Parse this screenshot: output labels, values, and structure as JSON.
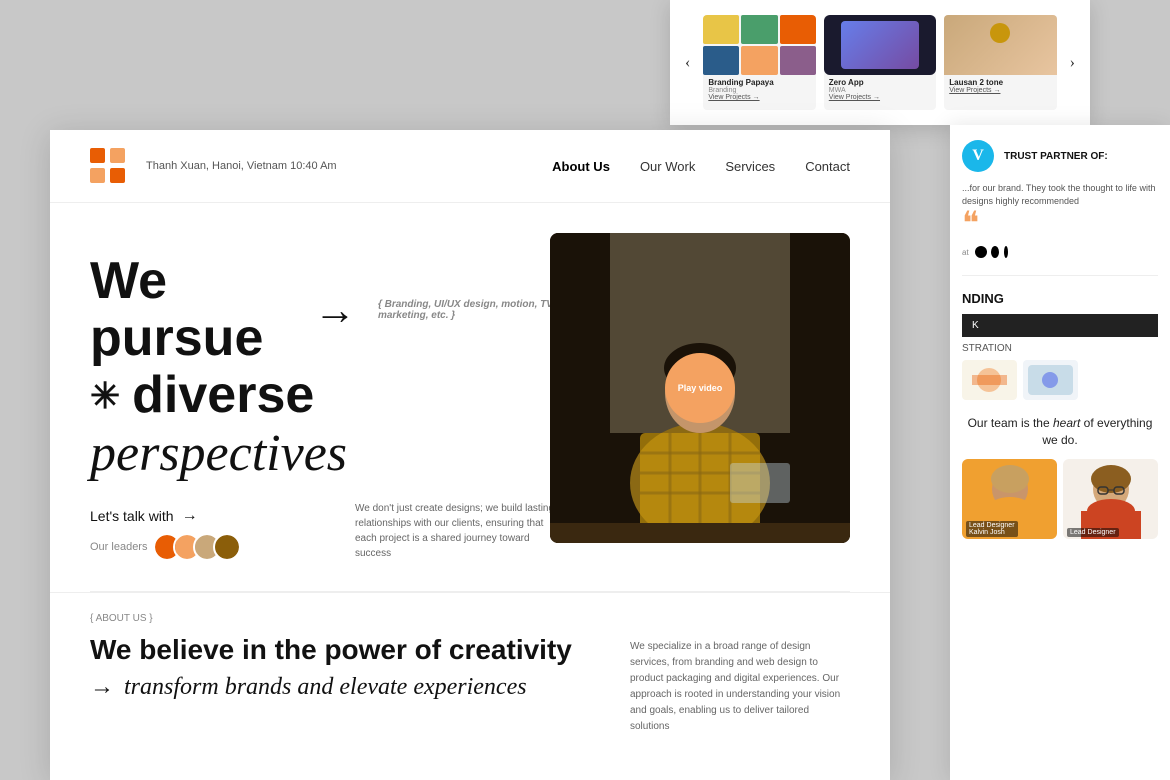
{
  "page": {
    "background": "#c8c8c8"
  },
  "nav": {
    "location": "Thanh Xuan, Hanoi, Vietnam 10:40 Am",
    "links": [
      "About Us",
      "Our Work",
      "Services",
      "Contact"
    ],
    "active": "About Us"
  },
  "hero": {
    "line1": "We pursue",
    "arrow": "→",
    "line1_sub": "{ Branding, UI/UX design, motion, TVC, marketing, etc. }",
    "line2_star": "✳",
    "line2": "diverse",
    "line3": "perspectives",
    "cta_label": "Let's talk with",
    "cta_arrow": "→",
    "leaders_label": "Our leaders",
    "desc": "We don't just create designs; we build lasting relationships with our clients, ensuring that each project is a shared journey toward success",
    "play_btn": "Play video"
  },
  "about": {
    "tag": "{ ABOUT US }",
    "title": "We believe in the power of creativity",
    "subtitle_arrow": "→",
    "subtitle": "transform brands and elevate experiences",
    "desc": "We specialize in a broad range of design services, from branding and web design to product packaging and digital experiences. Our approach is rooted in understanding your vision and goals, enabling us to deliver tailored solutions"
  },
  "right_panel": {
    "trust_header": "TRUST PARTNER OF:",
    "vimeo_icon": "V",
    "trust_text": "...for our brand. They took the thought to life with designs highly recommended",
    "quote_mark": "❝",
    "branding_title": "NDING",
    "branding_bar_text": "K",
    "branding_sub": "STRATION",
    "team_text_1": "Our team is the",
    "team_text_italic": "heart",
    "team_text_2": "of everything we do.",
    "lead_designer_1": "Lead Designer",
    "lead_designer_name_1": "Kalvin Josh",
    "lead_designer_2": "Lead Designer"
  },
  "portfolio": {
    "card1": {
      "title": "Branding Papaya",
      "sub": "Branding",
      "link": "View Projects →"
    },
    "card2": {
      "title": "Zero App",
      "sub": "MWA",
      "link": "View Projects →"
    },
    "card3": {
      "title": "Lausan 2 tone",
      "link": "View Projects →"
    }
  },
  "avatars": {
    "colors": [
      "#e85d04",
      "#f4a261",
      "#c9a87a",
      "#8b5e0a"
    ]
  }
}
